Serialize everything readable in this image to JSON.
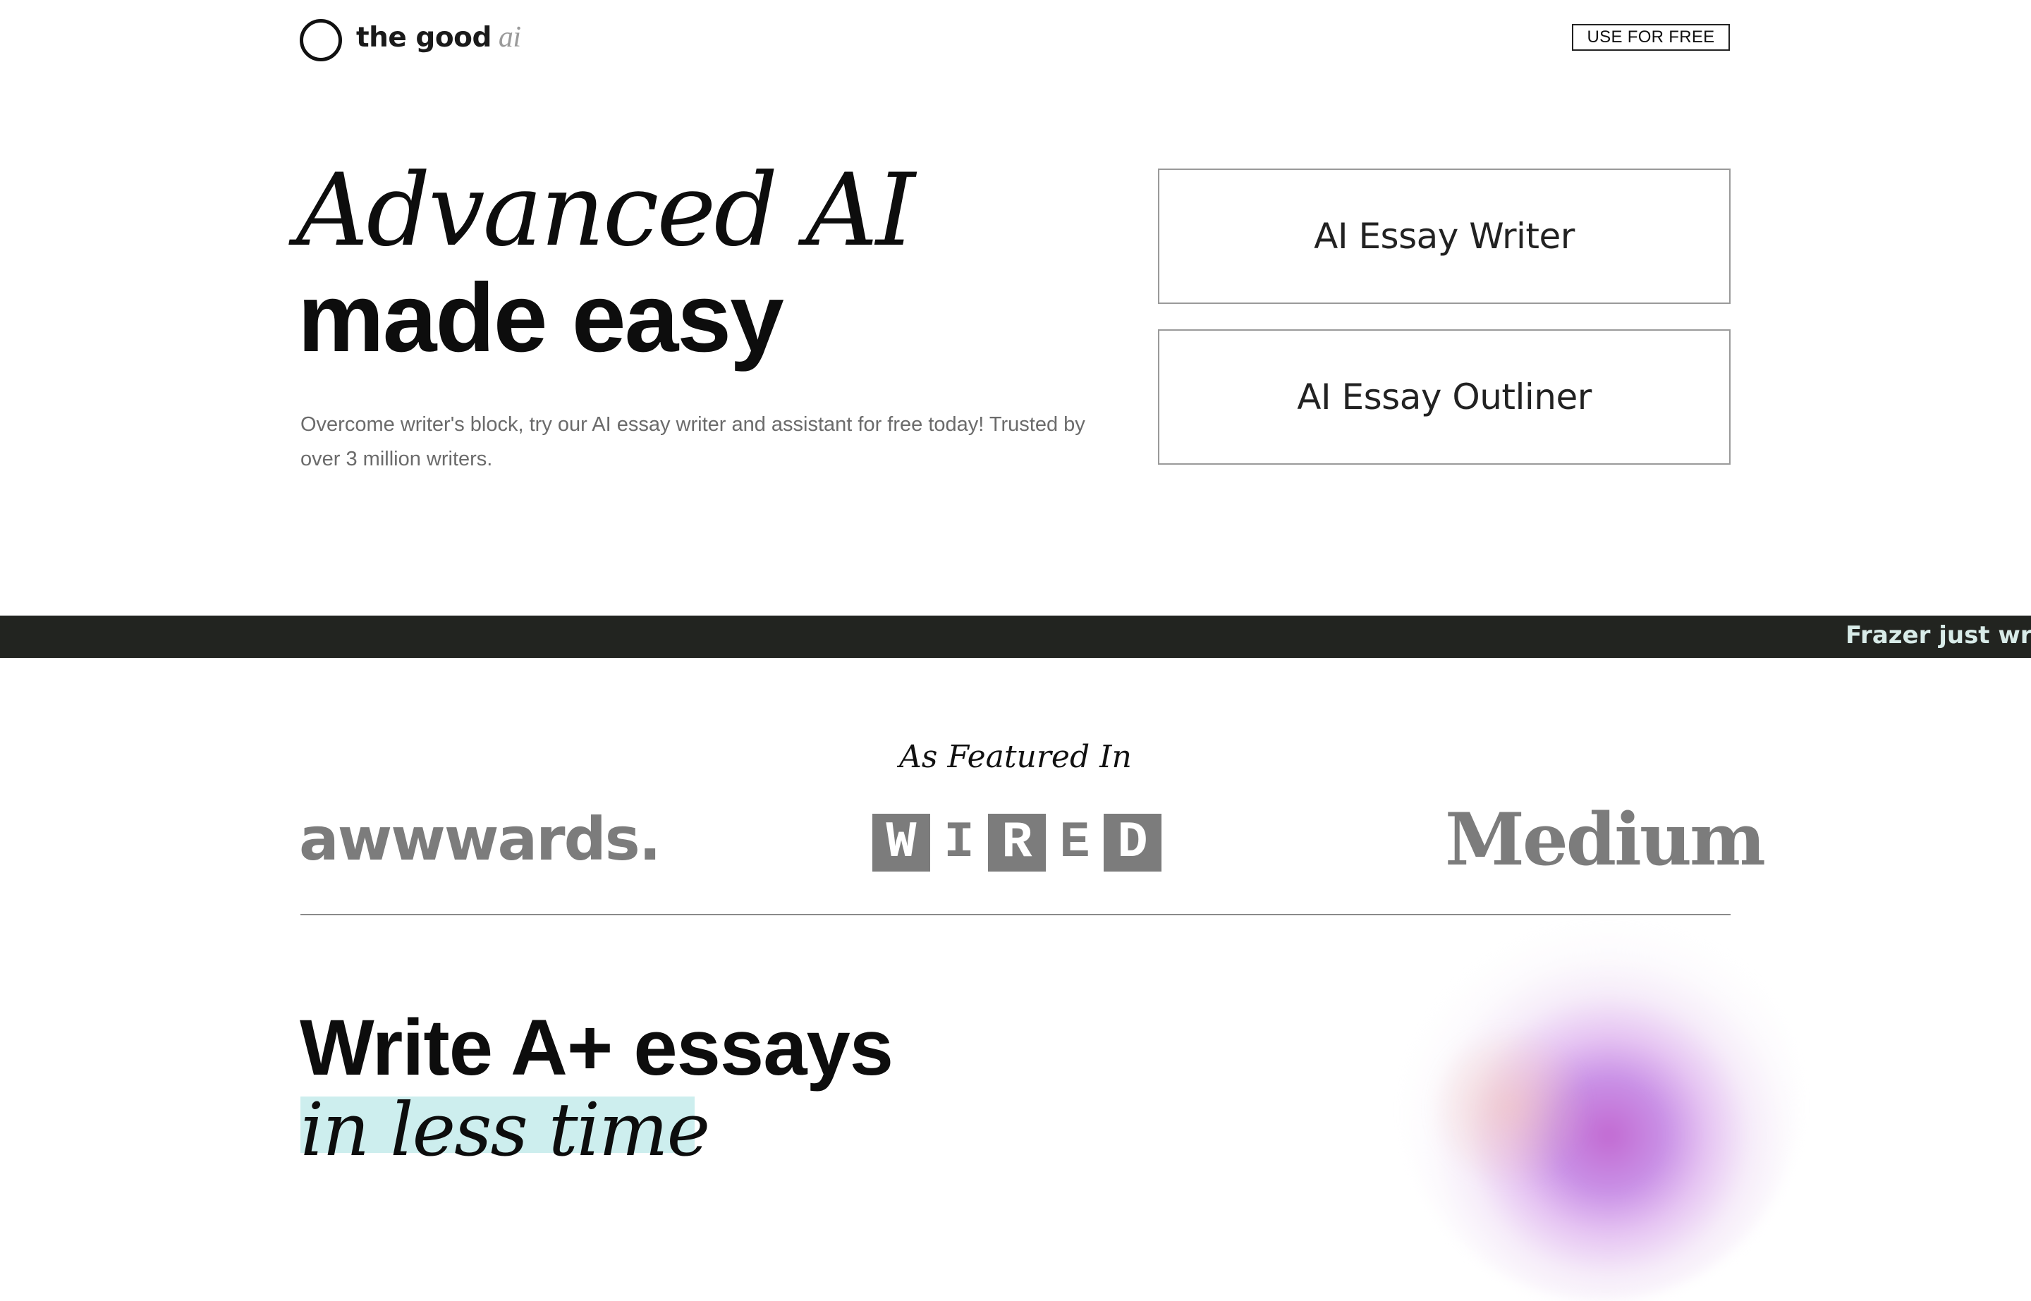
{
  "header": {
    "brand_main": "the good",
    "brand_accent": "ai",
    "cta_label": "USE FOR FREE"
  },
  "hero": {
    "headline_italic": "Advanced AI",
    "headline_bold": "made easy",
    "subtitle": "Overcome writer's block, try our AI essay writer and assistant for free today! Trusted by over 3 million writers.",
    "tools": [
      "AI Essay Writer",
      "AI Essay Outliner"
    ]
  },
  "ticker": {
    "text": "Frazer just wrot"
  },
  "featured": {
    "title": "As Featured In",
    "logos": {
      "awwwards": "awwwards.",
      "wired": [
        "W",
        "I",
        "R",
        "E",
        "D"
      ],
      "medium": "Medium"
    }
  },
  "section2": {
    "title": "Write A+ essays",
    "highlight": "in less time"
  },
  "colors": {
    "ticker_bg": "#222420",
    "ticker_text": "#d8ebe8",
    "logo_gray": "#7c7c7c",
    "highlight": "#cdeeee",
    "blob_accent": "#c26ad2"
  },
  "icons": {
    "logo": "circle-outline-icon"
  }
}
